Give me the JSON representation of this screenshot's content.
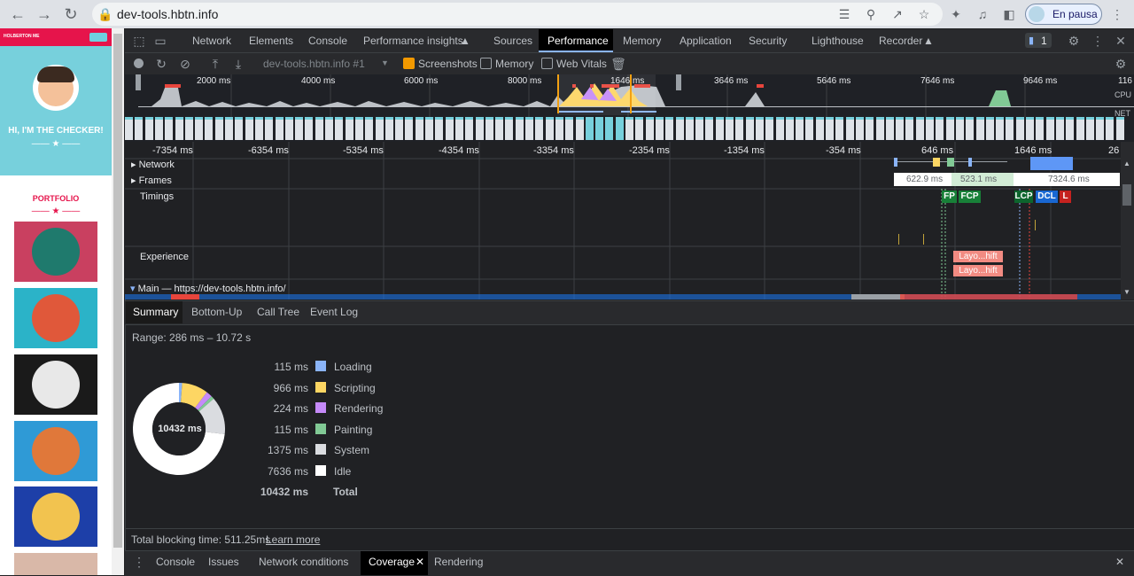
{
  "browser": {
    "url": "dev-tools.hbtn.info",
    "profile_label": "En pausa"
  },
  "page": {
    "brand": "HOLBERTON ME",
    "hero_title": "HI, I'M THE CHECKER!",
    "portfolio_label": "PORTFOLIO",
    "tiles": [
      {
        "bg": "#c94060",
        "circle": "#1f7a6d",
        "name": "cabin"
      },
      {
        "bg": "#2bb3c8",
        "circle": "#e0583a",
        "name": "cake"
      },
      {
        "bg": "#1a1a1a",
        "circle": "#e8e8e8",
        "name": "circus"
      },
      {
        "bg": "#2f9ad6",
        "circle": "#e0783a",
        "name": "gamepad"
      },
      {
        "bg": "#1d3fa8",
        "circle": "#f2c34f",
        "name": "safe"
      }
    ]
  },
  "devtools": {
    "tabs": [
      "Network",
      "Elements",
      "Console",
      "Performance insights",
      "Sources",
      "Performance",
      "Memory",
      "Application",
      "Security",
      "Lighthouse",
      "Recorder"
    ],
    "active_tab": "Performance",
    "issues_count": "1",
    "toolbar": {
      "recording": "dev-tools.hbtn.info #1",
      "screenshots_label": "Screenshots",
      "memory_label": "Memory",
      "web_vitals_label": "Web Vitals"
    },
    "overview": {
      "ticks": [
        "2000 ms",
        "4000 ms",
        "6000 ms",
        "8000 ms",
        "1646 ms",
        "3646 ms",
        "5646 ms",
        "7646 ms",
        "9646 ms",
        "116"
      ],
      "cpu_label": "CPU",
      "net_label": "NET"
    },
    "flame": {
      "ticks": [
        "-7354 ms",
        "-6354 ms",
        "-5354 ms",
        "-4354 ms",
        "-3354 ms",
        "-2354 ms",
        "-1354 ms",
        "-354 ms",
        "646 ms",
        "1646 ms",
        "26"
      ],
      "tracks": {
        "network": "Network",
        "frames": "Frames",
        "timings": "Timings",
        "experience": "Experience",
        "main": "Main — https://dev-tools.hbtn.info/"
      },
      "frame_times": [
        "622.9 ms",
        "523.1 ms",
        "7324.6 ms"
      ],
      "markers": [
        "FP",
        "FCP",
        "LCP",
        "DCL",
        "L"
      ],
      "layout_shift": "Layo...hift"
    },
    "bottom_tabs": [
      "Summary",
      "Bottom-Up",
      "Call Tree",
      "Event Log"
    ],
    "summary": {
      "range": "Range: 286 ms – 10.72 s",
      "total_label": "10432 ms",
      "items": [
        {
          "value": "115 ms",
          "name": "Loading",
          "color": "#8ab4f8"
        },
        {
          "value": "966 ms",
          "name": "Scripting",
          "color": "#fdd663"
        },
        {
          "value": "224 ms",
          "name": "Rendering",
          "color": "#c58af9"
        },
        {
          "value": "115 ms",
          "name": "Painting",
          "color": "#81c995"
        },
        {
          "value": "1375 ms",
          "name": "System",
          "color": "#dadce0"
        },
        {
          "value": "7636 ms",
          "name": "Idle",
          "color": "#ffffff"
        }
      ],
      "total_value": "10432 ms",
      "total_name": "Total",
      "tbt": "Total blocking time: 511.25ms",
      "learn_more": "Learn more"
    },
    "drawer_tabs": [
      "Console",
      "Issues",
      "Network conditions",
      "Coverage",
      "Rendering"
    ]
  }
}
